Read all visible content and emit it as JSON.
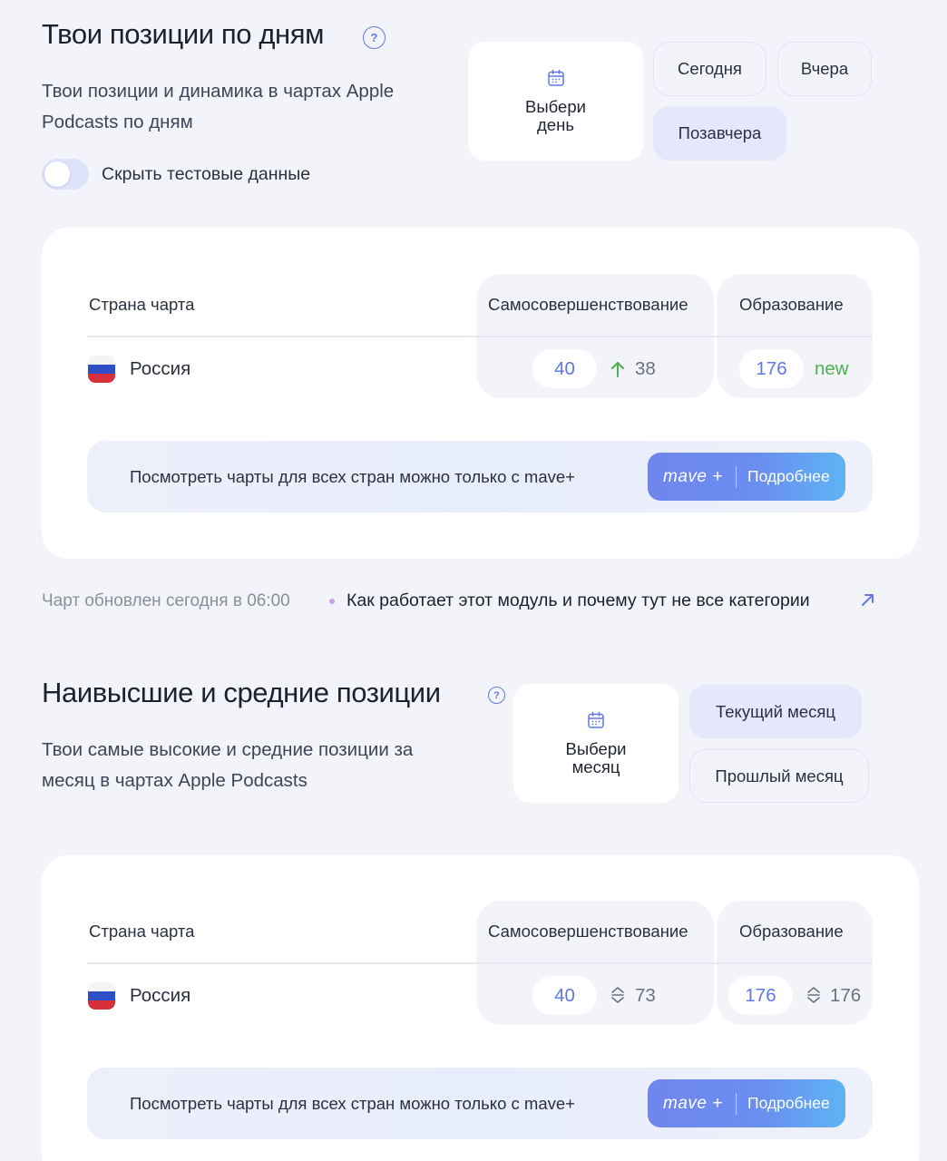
{
  "daily": {
    "title": "Твои позиции по дням",
    "description_line1": "Твои позиции и динамика в чартах Apple",
    "description_line2": "Podcasts по дням",
    "toggle_label": "Скрыть тестовые данные",
    "toggle_on": false,
    "picker_label": "Выбери\nдень",
    "buttons": {
      "today": "Сегодня",
      "yesterday": "Вчера",
      "day_before": "Позавчера"
    },
    "active_button": "Позавчера",
    "table": {
      "col_country": "Страна чарта",
      "col_cat1": "Самосовершенствование",
      "col_cat2": "Образование",
      "row": {
        "country": "Россия",
        "cat1_rank": "40",
        "cat1_prev": "38",
        "cat1_trend": "up",
        "cat2_rank": "176",
        "cat2_status": "new"
      }
    },
    "banner": {
      "text": "Посмотреть чарты для всех стран можно только с mave+",
      "logo": "mave +",
      "button": "Подробнее"
    }
  },
  "footnote": {
    "updated": "Чарт обновлен сегодня в 06:00",
    "link": "Как работает этот модуль и почему тут не все категории"
  },
  "monthly": {
    "title": "Наивысшие и средние позиции",
    "description_line1": "Твои самые высокие и средние позиции за",
    "description_line2": "месяц в чартах Apple Podcasts",
    "picker_label": "Выбери\nмесяц",
    "buttons": {
      "current": "Текущий месяц",
      "previous": "Прошлый месяц"
    },
    "active_button": "Текущий месяц",
    "table": {
      "col_country": "Страна чарта",
      "col_cat1": "Самосовершенствование",
      "col_cat2": "Образование",
      "row": {
        "country": "Россия",
        "cat1_best": "40",
        "cat1_avg": "73",
        "cat2_best": "176",
        "cat2_avg": "176"
      }
    },
    "banner": {
      "text": "Посмотреть чарты для всех стран можно только с mave+",
      "logo": "mave +",
      "button": "Подробнее"
    }
  },
  "colors": {
    "accent": "#5f78e6",
    "up": "#4caf50",
    "page_bg": "#f3f4f9"
  }
}
